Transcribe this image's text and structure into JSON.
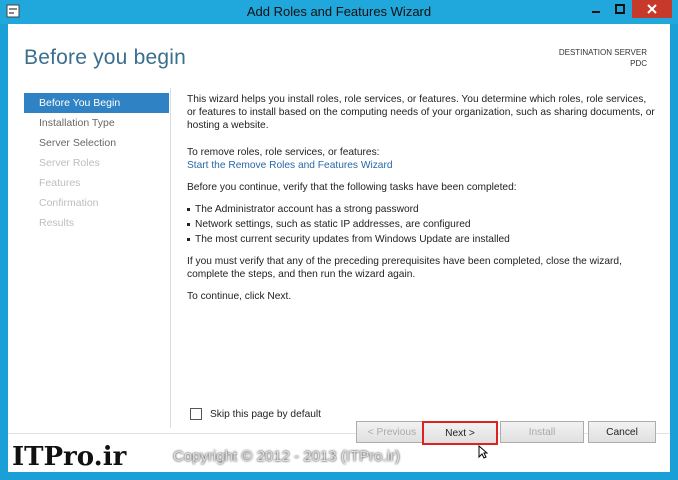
{
  "window": {
    "title": "Add Roles and Features Wizard",
    "accent": "#1a9fd6",
    "close_color": "#c7392a"
  },
  "header": {
    "heading": "Before you begin",
    "dest_label": "DESTINATION SERVER",
    "dest_value": "PDC"
  },
  "nav": {
    "items": [
      {
        "label": "Before You Begin",
        "state": "active"
      },
      {
        "label": "Installation Type",
        "state": "enabled"
      },
      {
        "label": "Server Selection",
        "state": "enabled"
      },
      {
        "label": "Server Roles",
        "state": "disabled"
      },
      {
        "label": "Features",
        "state": "disabled"
      },
      {
        "label": "Confirmation",
        "state": "disabled"
      },
      {
        "label": "Results",
        "state": "disabled"
      }
    ]
  },
  "content": {
    "intro": "This wizard helps you install roles, role services, or features. You determine which roles, role services, or features to install based on the computing needs of your organization, such as sharing documents, or hosting a website.",
    "remove_prompt": "To remove roles, role services, or features:",
    "remove_link": "Start the Remove Roles and Features Wizard",
    "verify_intro": "Before you continue, verify that the following tasks have been completed:",
    "bullets": [
      "The Administrator account has a strong password",
      "Network settings, such as static IP addresses, are configured",
      "The most current security updates from Windows Update are installed"
    ],
    "prereq_note": "If you must verify that any of the preceding prerequisites have been completed, close the wizard, complete the steps, and then run the wizard again.",
    "continue_note": "To continue, click Next."
  },
  "skip": {
    "label": "Skip this page by default",
    "checked": false
  },
  "buttons": {
    "previous": "< Previous",
    "next": "Next >",
    "install": "Install",
    "cancel": "Cancel"
  },
  "overlay": {
    "watermark": "ITPro.ir",
    "copyright": "Copyright © 2012 - 2013 (ITPro.ir)"
  }
}
